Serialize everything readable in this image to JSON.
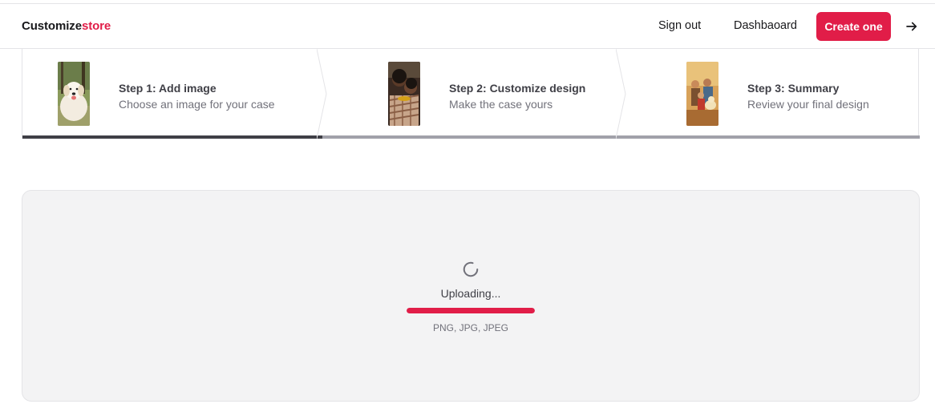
{
  "header": {
    "logo_main": "Customize",
    "logo_accent": "store",
    "signout_label": "Sign out",
    "dashboard_label": "Dashbaoard",
    "create_label": "Create one",
    "arrow_icon": "arrow-right-icon"
  },
  "steps": [
    {
      "title": "Step 1: Add image",
      "description": "Choose an image for your case",
      "thumb": "dog-photo",
      "state": "current"
    },
    {
      "title": "Step 2: Customize design",
      "description": "Make the case yours",
      "thumb": "people-photo",
      "state": "upcoming"
    },
    {
      "title": "Step 3: Summary",
      "description": "Review your final design",
      "thumb": "family-dog-photo",
      "state": "upcoming"
    }
  ],
  "dropzone": {
    "status_text": "Uploading...",
    "spinner_icon": "loader-icon",
    "progress": 1.0,
    "formats_text": "PNG, JPG, JPEG"
  },
  "colors": {
    "accent": "#e11d48",
    "active_step_bar": "#3f3f46",
    "inactive_step_bar": "#a1a1aa",
    "dropzone_bg": "#f3f3f4"
  }
}
